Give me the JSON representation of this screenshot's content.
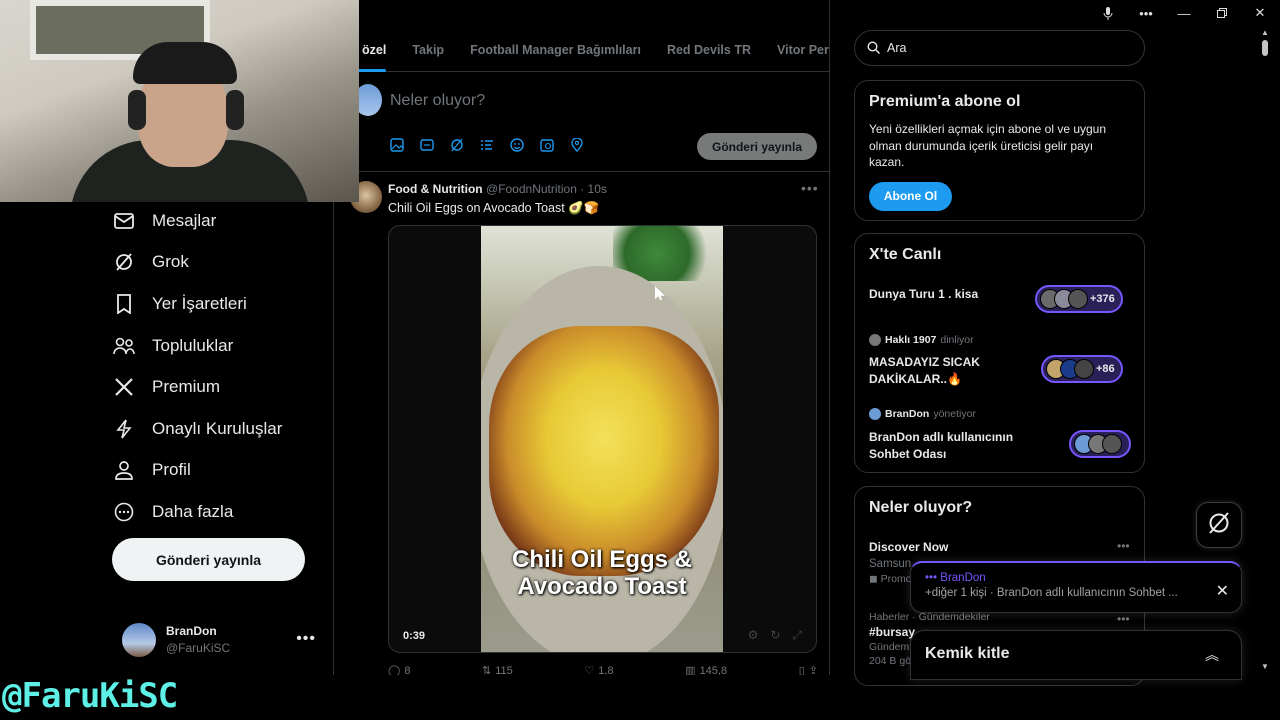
{
  "window": {
    "controls": [
      "mic-icon",
      "more-icon",
      "minimize-icon",
      "maximize-icon",
      "close-icon"
    ]
  },
  "overlay_handle": "@FaruKiSC",
  "sidebar": {
    "items": [
      {
        "label": "Mesajlar",
        "icon": "mail-icon"
      },
      {
        "label": "Grok",
        "icon": "grok-icon"
      },
      {
        "label": "Yer İşaretleri",
        "icon": "bookmark-icon"
      },
      {
        "label": "Topluluklar",
        "icon": "communities-icon"
      },
      {
        "label": "Premium",
        "icon": "x-logo-icon"
      },
      {
        "label": "Onaylı Kuruluşlar",
        "icon": "lightning-icon"
      },
      {
        "label": "Profil",
        "icon": "profile-icon"
      },
      {
        "label": "Daha fazla",
        "icon": "more-circle-icon"
      }
    ],
    "post_button": "Gönderi yayınla",
    "account": {
      "name": "BranDon",
      "handle": "@FaruKiSC"
    }
  },
  "timeline": {
    "tabs": [
      {
        "label": "ana özel",
        "active": true
      },
      {
        "label": "Takip",
        "active": false
      },
      {
        "label": "Football Manager Bağımlıları",
        "active": false
      },
      {
        "label": "Red Devils TR",
        "active": false
      },
      {
        "label": "Vitor Pere",
        "active": false
      }
    ],
    "compose_placeholder": "Neler oluyor?",
    "compose_button": "Gönderi yayınla",
    "tweet": {
      "author": "Food & Nutrition",
      "handle": "@FoodnNutrition",
      "time": "· 10s",
      "text": "Chili Oil Eggs on Avocado Toast 🥑🍞",
      "video_caption_1": "Chili Oil Eggs &",
      "video_caption_2": "Avocado Toast",
      "video_time": "0:39",
      "replies": "8",
      "retweets": "115",
      "likes": "1,8",
      "views": "145,8"
    }
  },
  "right": {
    "search_placeholder": "Ara",
    "premium": {
      "title": "Premium'a abone ol",
      "text": "Yeni özellikleri açmak için abone ol ve uygun olman durumunda içerik üreticisi gelir payı kazan.",
      "button": "Abone Ol"
    },
    "live": {
      "title": "X'te Canlı",
      "spaces": [
        {
          "title": "Dunya Turu 1 . kisa",
          "host": "",
          "role": "",
          "count": "+376"
        },
        {
          "title": "MASADAYIZ SICAK DAKİKALAR..🔥",
          "host": "Haklı 1907",
          "role": "dinliyor",
          "count": "+86"
        },
        {
          "title": "BranDon adlı kullanıcının Sohbet Odası",
          "host": "BranDon",
          "role": "yönetiyor",
          "count": ""
        }
      ]
    },
    "trends": {
      "title": "Neler oluyor?",
      "items": [
        {
          "name": "Discover Now",
          "context": "Samsun",
          "extra": "Promo"
        },
        {
          "context": "Haberler · Gündemdekiler",
          "name": "#bursay",
          "extra": "Gündem",
          "posts": "204 B gö"
        }
      ]
    },
    "toast": {
      "title": "••• BranDon",
      "text": "+diğer 1 kişi · BranDon adlı kullanıcının Sohbet ..."
    },
    "chat_title": "Kemik kitle"
  }
}
